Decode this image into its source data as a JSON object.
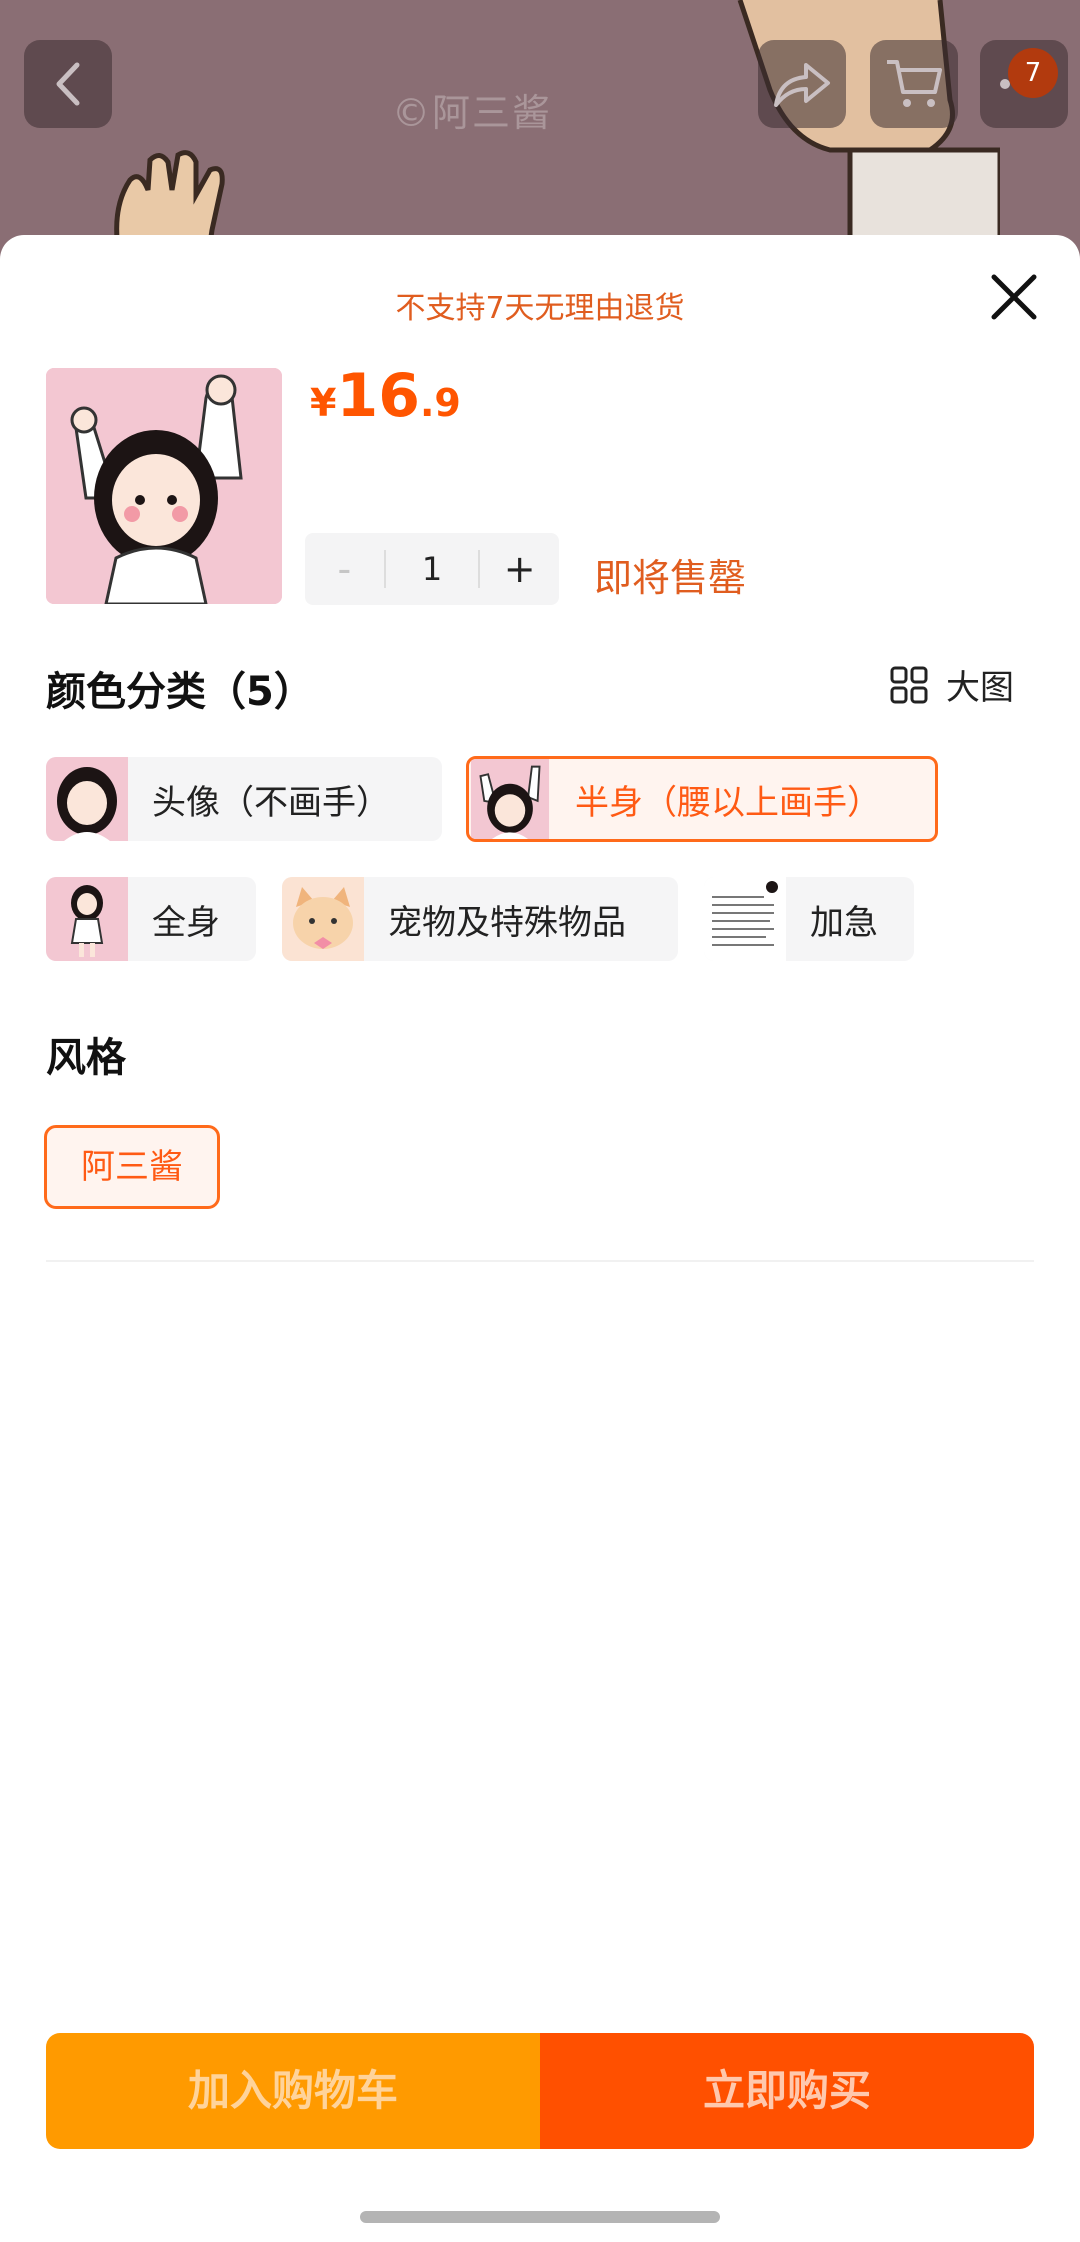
{
  "background": {
    "watermark": "©阿三酱",
    "cart_badge_count": "7"
  },
  "sheet": {
    "notice": "不支持7天无理由退货",
    "price": {
      "currency": "¥",
      "integer": "16",
      "decimal": ".9"
    },
    "quantity": {
      "minus": "-",
      "value": "1",
      "plus": "+"
    },
    "stock_tip": "即将售罄",
    "color_section": {
      "title": "颜色分类（5）",
      "big_view_label": "大图",
      "options": [
        {
          "label": "头像（不画手）",
          "selected": false
        },
        {
          "label": "半身（腰以上画手）",
          "selected": true
        },
        {
          "label": "全身",
          "selected": false
        },
        {
          "label": "宠物及特殊物品",
          "selected": false
        },
        {
          "label": "加急",
          "selected": false
        }
      ]
    },
    "style_section": {
      "title": "风格",
      "options": [
        {
          "label": "阿三酱",
          "selected": true
        }
      ]
    }
  },
  "bottom_bar": {
    "add_to_cart": "加入购物车",
    "buy_now": "立即购买"
  },
  "colors": {
    "accent": "#ff5500",
    "cart_button": "#ff9a00",
    "buy_button": "#ff5000",
    "overlay_bg": "#8a6e74"
  }
}
